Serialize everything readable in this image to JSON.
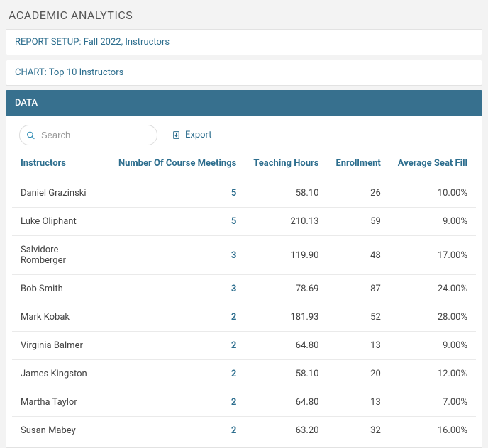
{
  "page_title": "ACADEMIC ANALYTICS",
  "report_setup": "REPORT SETUP: Fall 2022, Instructors",
  "chart_link": "CHART: Top 10 Instructors",
  "data_header": "DATA",
  "search": {
    "placeholder": "Search"
  },
  "export_label": "Export",
  "columns": {
    "instructors": "Instructors",
    "meetings": "Number Of Course Meetings",
    "hours": "Teaching Hours",
    "enrollment": "Enrollment",
    "seatfill": "Average Seat Fill"
  },
  "rows": [
    {
      "name": "Daniel Grazinski",
      "meetings": "5",
      "hours": "58.10",
      "enrollment": "26",
      "seatfill": "10.00%"
    },
    {
      "name": "Luke Oliphant",
      "meetings": "5",
      "hours": "210.13",
      "enrollment": "59",
      "seatfill": "9.00%"
    },
    {
      "name": "Salvidore Romberger",
      "meetings": "3",
      "hours": "119.90",
      "enrollment": "48",
      "seatfill": "17.00%"
    },
    {
      "name": "Bob Smith",
      "meetings": "3",
      "hours": "78.69",
      "enrollment": "87",
      "seatfill": "24.00%"
    },
    {
      "name": "Mark Kobak",
      "meetings": "2",
      "hours": "181.93",
      "enrollment": "52",
      "seatfill": "28.00%"
    },
    {
      "name": "Virginia Balmer",
      "meetings": "2",
      "hours": "64.80",
      "enrollment": "13",
      "seatfill": "9.00%"
    },
    {
      "name": "James Kingston",
      "meetings": "2",
      "hours": "58.10",
      "enrollment": "20",
      "seatfill": "12.00%"
    },
    {
      "name": "Martha Taylor",
      "meetings": "2",
      "hours": "64.80",
      "enrollment": "13",
      "seatfill": "7.00%"
    },
    {
      "name": "Susan Mabey",
      "meetings": "2",
      "hours": "63.20",
      "enrollment": "32",
      "seatfill": "16.00%"
    }
  ]
}
